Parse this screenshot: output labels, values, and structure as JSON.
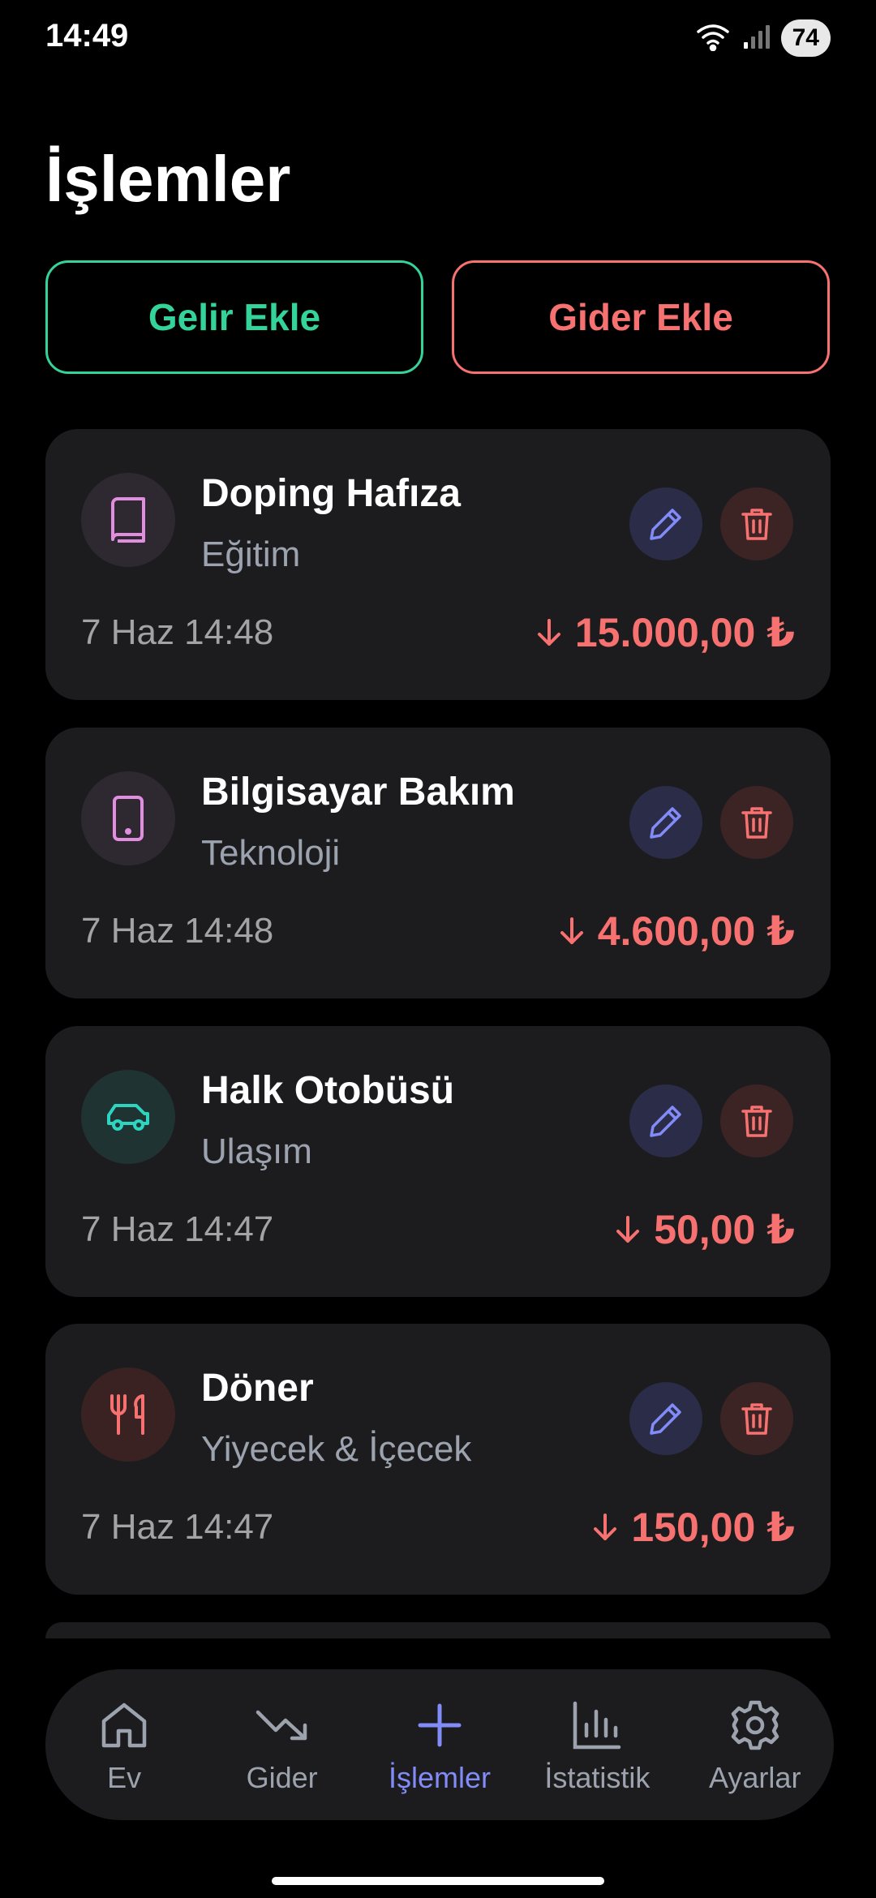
{
  "status_bar": {
    "time": "14:49",
    "battery": "74",
    "icons": [
      "wifi-icon",
      "signal-icon",
      "battery-icon"
    ]
  },
  "page_title": "İşlemler",
  "actions": {
    "income_label": "Gelir Ekle",
    "expense_label": "Gider Ekle"
  },
  "colors": {
    "income": "#34d399",
    "expense": "#f87171",
    "accent": "#818cf8",
    "card": "#1c1c1e"
  },
  "transactions": [
    {
      "title": "Doping Hafıza",
      "category": "Eğitim",
      "date": "7 Haz 14:48",
      "amount": "15.000,00 ₺",
      "icon": "book-icon"
    },
    {
      "title": "Bilgisayar Bakım",
      "category": "Teknoloji",
      "date": "7 Haz 14:48",
      "amount": "4.600,00 ₺",
      "icon": "device-icon"
    },
    {
      "title": "Halk Otobüsü",
      "category": "Ulaşım",
      "date": "7 Haz 14:47",
      "amount": "50,00 ₺",
      "icon": "car-icon"
    },
    {
      "title": "Döner",
      "category": "Yiyecek & İçecek",
      "date": "7 Haz 14:47",
      "amount": "150,00 ₺",
      "icon": "utensils-icon"
    }
  ],
  "nav": {
    "items": [
      {
        "label": "Ev",
        "icon": "home-icon"
      },
      {
        "label": "Gider",
        "icon": "trending-down-icon"
      },
      {
        "label": "İşlemler",
        "icon": "plus-icon",
        "active": true
      },
      {
        "label": "İstatistik",
        "icon": "bar-chart-icon"
      },
      {
        "label": "Ayarlar",
        "icon": "gear-icon"
      }
    ]
  }
}
